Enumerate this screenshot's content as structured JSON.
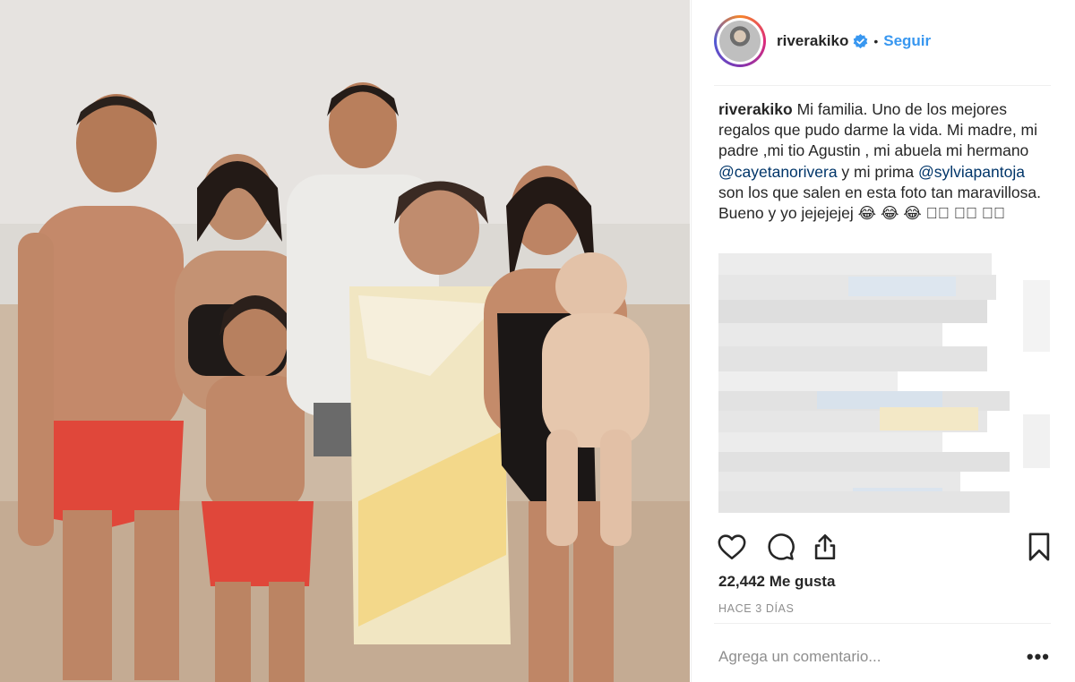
{
  "post": {
    "image_alt": "Foto familiar en la playa",
    "username": "riverakiko",
    "follow_label": "Seguir",
    "separator": "•",
    "caption_user": "riverakiko",
    "caption_part1": "Mi familia. Uno de los mejores regalos que pudo darme la vida. Mi madre, mi padre ,mi tio Agustin , mi abuela mi hermano ",
    "mention1": "@cayetanorivera",
    "caption_part2": " y mi prima ",
    "mention2": "@sylviapantoja",
    "caption_part3": " son los que salen en esta foto tan maravillosa. Bueno y yo jejejejej 😂 😂 😂 ◻🏻 ◻🏻 ◻🏻",
    "likes": "22,442 Me gusta",
    "time_ago": "HACE 3 DÍAS",
    "comment_placeholder": "Agrega un comentario...",
    "more_label": "•••"
  },
  "colors": {
    "link": "#3897f0",
    "mention": "#003569",
    "secondary": "#8e8e8e",
    "text": "#262626"
  },
  "icons": [
    "heart-icon",
    "comment-icon",
    "share-icon",
    "bookmark-icon",
    "verified-icon"
  ]
}
